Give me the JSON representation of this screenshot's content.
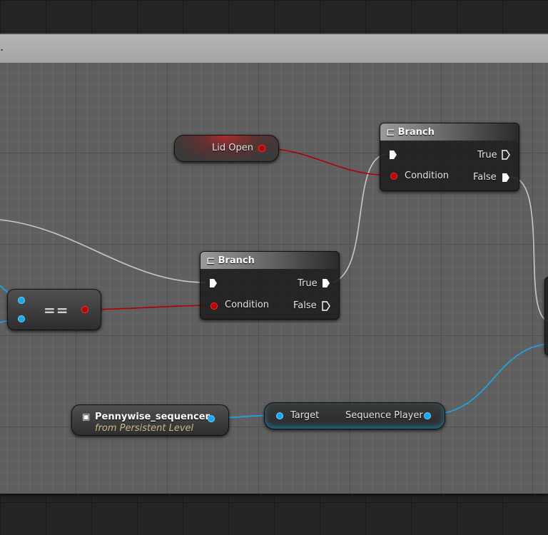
{
  "comment": {
    "title": "."
  },
  "nodes": {
    "lid_open": {
      "label": "Lid Open"
    },
    "branch_top": {
      "title": "Branch",
      "true_label": "True",
      "condition_label": "Condition",
      "false_label": "False"
    },
    "branch_mid": {
      "title": "Branch",
      "true_label": "True",
      "condition_label": "Condition",
      "false_label": "False"
    },
    "equals": {
      "label": "=="
    },
    "sequencer_var": {
      "name": "Pennywise_sequencer",
      "subtitle": "from Persistent Level"
    },
    "sequence_player": {
      "target_label": "Target",
      "output_label": "Sequence Player"
    }
  },
  "colors": {
    "exec_wire": "#c8c8c8",
    "bool_wire": "#b00000",
    "object_wire": "#1aa7f0"
  }
}
